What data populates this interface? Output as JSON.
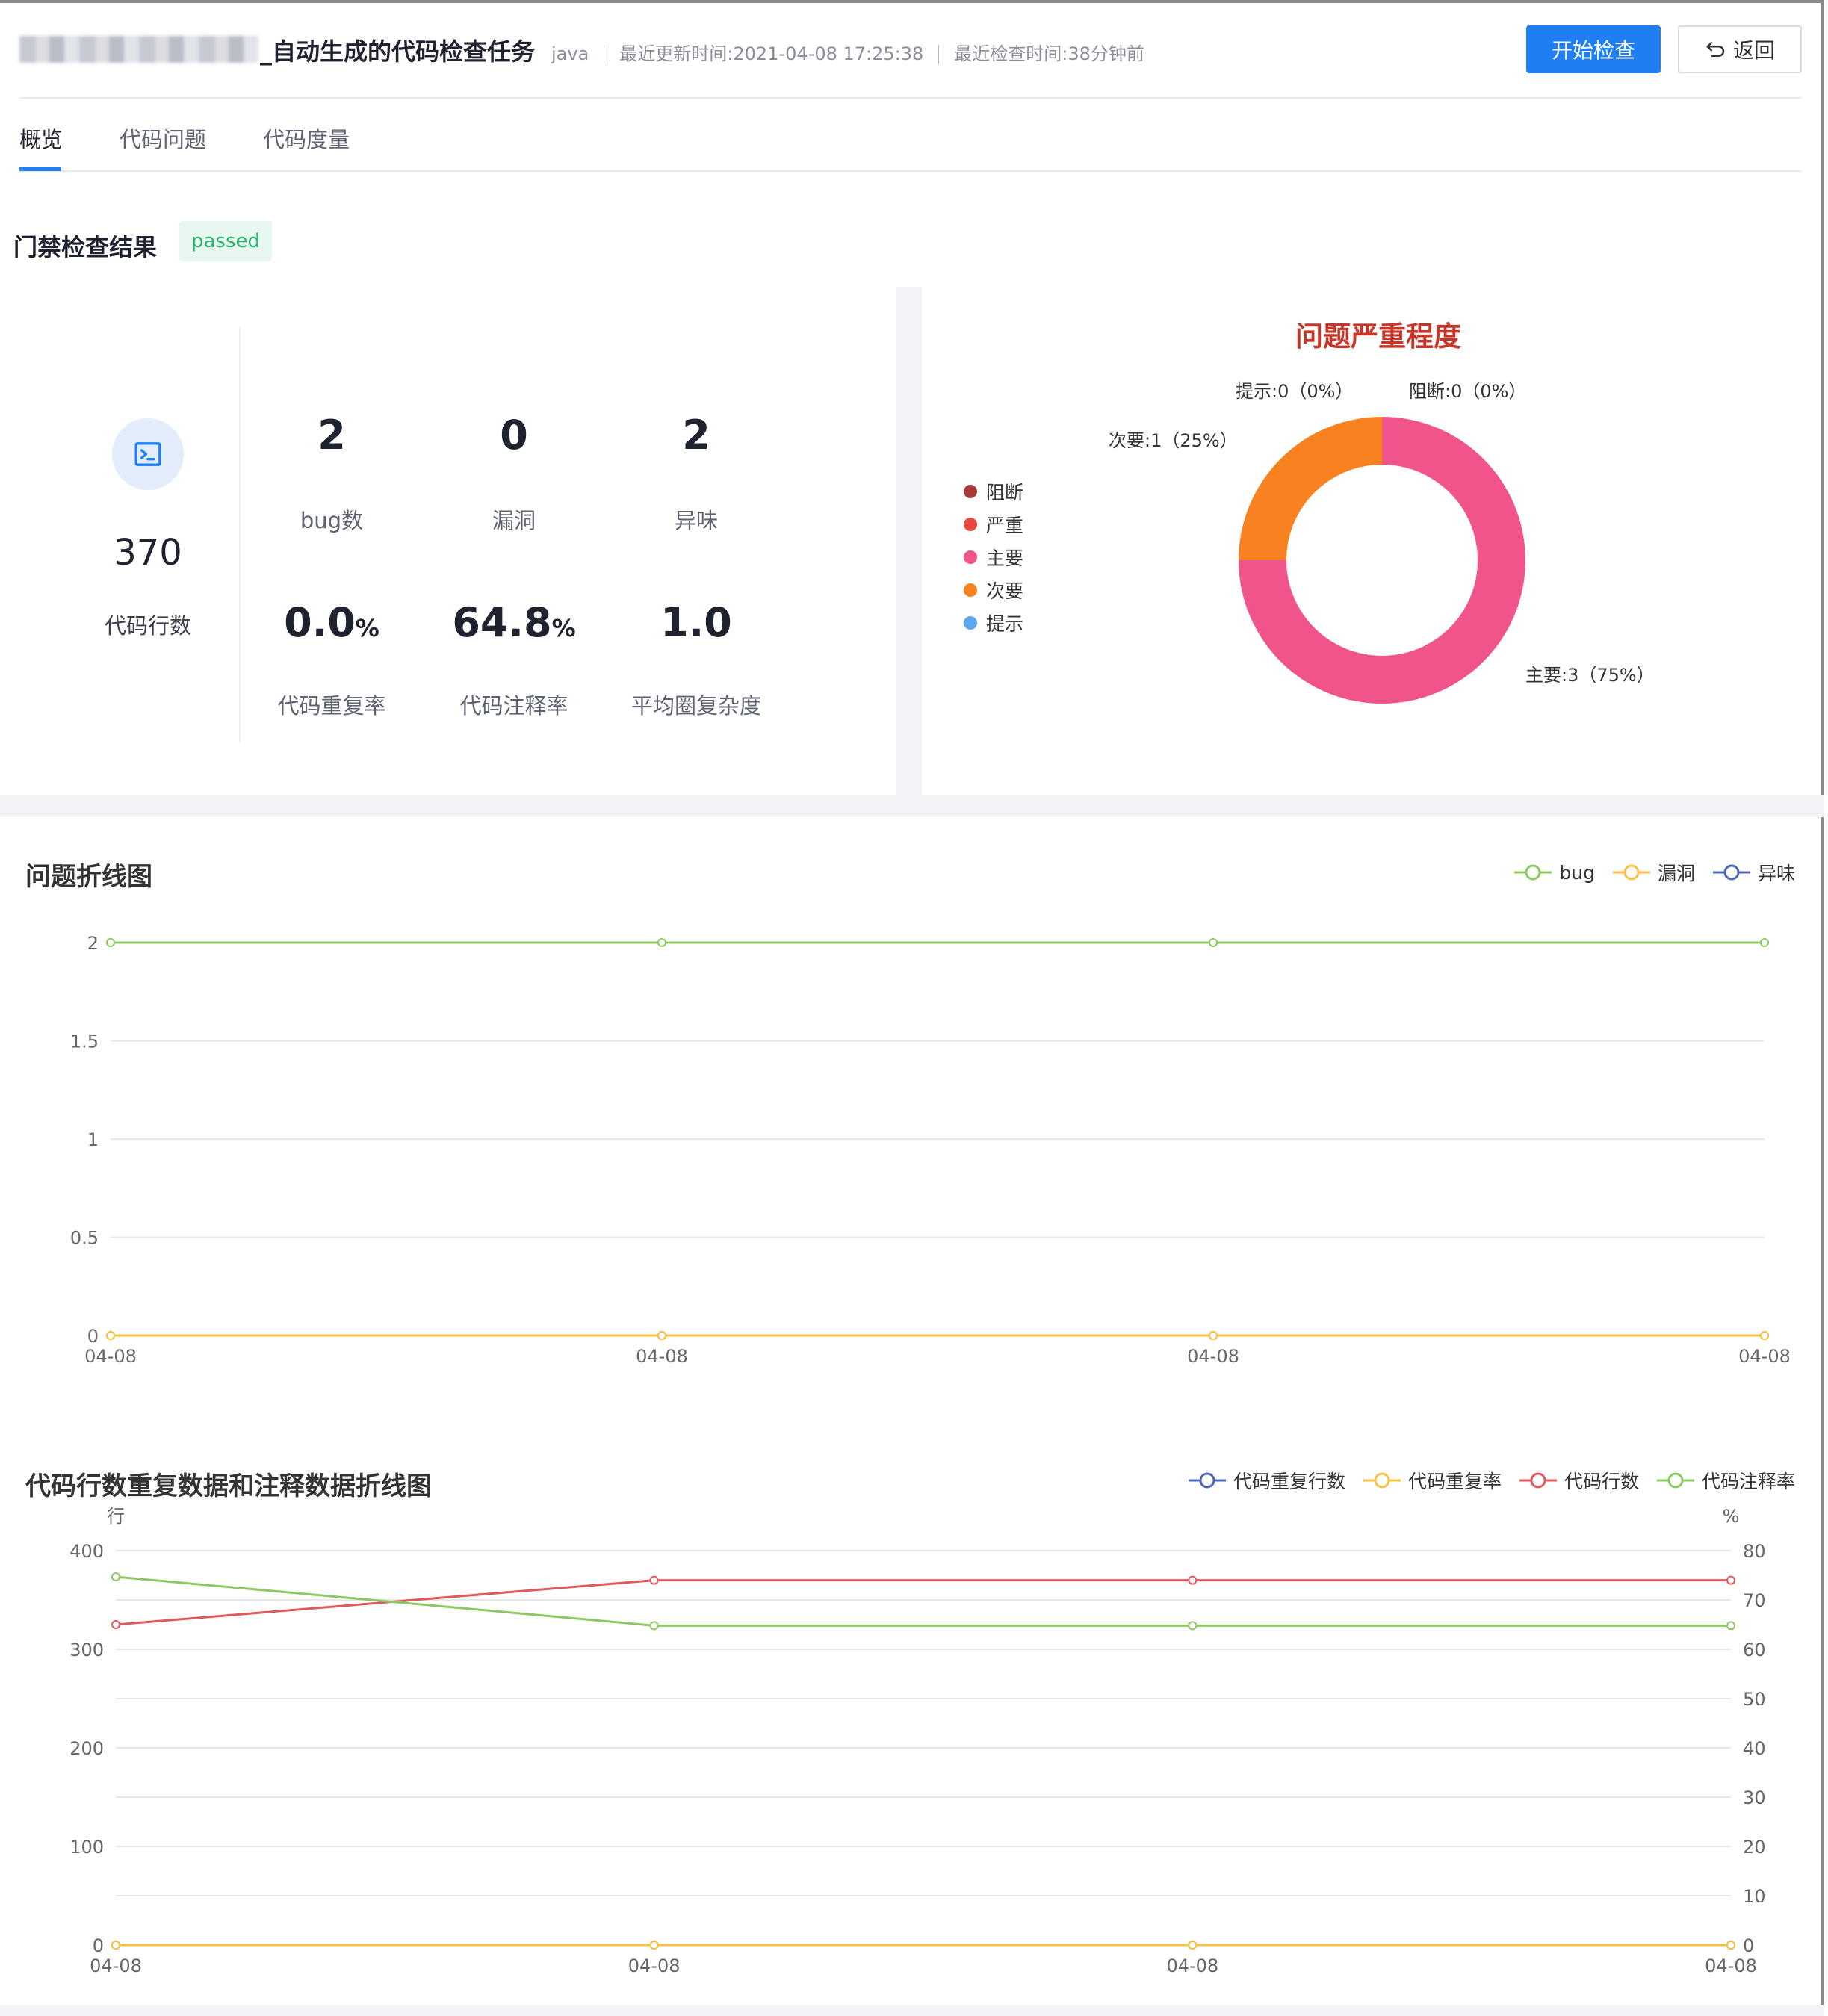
{
  "header": {
    "task_title": "_自动生成的代码检查任务",
    "language": "java",
    "updated_at": "最近更新时间:2021-04-08 17:25:38",
    "checked_at": "最近检查时间:38分钟前",
    "start_button": "开始检查",
    "back_button": "返回"
  },
  "tabs": [
    {
      "label": "概览",
      "active": true
    },
    {
      "label": "代码问题",
      "active": false
    },
    {
      "label": "代码度量",
      "active": false
    }
  ],
  "gate": {
    "title": "门禁检查结果",
    "status": "passed",
    "status_color": "#27b36b"
  },
  "stats": {
    "lines_of_code": {
      "value": "370",
      "label": "代码行数",
      "icon": "terminal-icon"
    },
    "bugs": {
      "value": "2",
      "label": "bug数"
    },
    "vulnerabilities": {
      "value": "0",
      "label": "漏洞"
    },
    "code_smells": {
      "value": "2",
      "label": "异味"
    },
    "duplication": {
      "value": "0.0",
      "unit": "%",
      "label": "代码重复率"
    },
    "comment_rate": {
      "value": "64.8",
      "unit": "%",
      "label": "代码注释率"
    },
    "complexity": {
      "value": "1.0",
      "label": "平均圈复杂度"
    }
  },
  "severity_chart": {
    "title": "问题严重程度",
    "legend": [
      {
        "label": "阻断",
        "color": "#a83a3a"
      },
      {
        "label": "严重",
        "color": "#e8483d"
      },
      {
        "label": "主要",
        "color": "#f0548b"
      },
      {
        "label": "次要",
        "color": "#f8821f"
      },
      {
        "label": "提示",
        "color": "#5ca8ef"
      }
    ],
    "labels": {
      "blocker": "阻断:0（0%）",
      "info": "提示:0（0%）",
      "minor": "次要:1（25%）",
      "major": "主要:3（75%）"
    }
  },
  "issue_chart": {
    "title": "问题折线图",
    "legend": [
      "bug",
      "漏洞",
      "异味"
    ],
    "y_ticks": [
      "2",
      "1.5",
      "1",
      "0.5",
      "0"
    ],
    "x_ticks": [
      "04-08",
      "04-08",
      "04-08",
      "04-08"
    ]
  },
  "metric_chart": {
    "title": "代码行数重复数据和注释数据折线图",
    "legend": [
      "代码重复行数",
      "代码重复率",
      "代码行数",
      "代码注释率"
    ],
    "left_unit": "行",
    "right_unit": "%",
    "left_ticks": [
      "400",
      "300",
      "200",
      "100",
      "0"
    ],
    "right_ticks": [
      "80",
      "70",
      "60",
      "50",
      "40",
      "30",
      "20",
      "10",
      "0"
    ],
    "x_ticks": [
      "04-08",
      "04-08",
      "04-08",
      "04-08"
    ]
  },
  "chart_data": [
    {
      "type": "pie",
      "title": "问题严重程度",
      "categories": [
        "阻断",
        "严重",
        "主要",
        "次要",
        "提示"
      ],
      "values": [
        0,
        0,
        3,
        1,
        0
      ],
      "colors": [
        "#a83a3a",
        "#e8483d",
        "#f0548b",
        "#f8821f",
        "#5ca8ef"
      ],
      "legend": "left"
    },
    {
      "type": "line",
      "title": "问题折线图",
      "x": [
        "04-08",
        "04-08",
        "04-08",
        "04-08"
      ],
      "series": [
        {
          "name": "bug",
          "values": [
            2,
            2,
            2,
            2
          ],
          "color": "#8cc963"
        },
        {
          "name": "漏洞",
          "values": [
            0,
            0,
            0,
            0
          ],
          "color": "#f7c244"
        },
        {
          "name": "异味",
          "values": [
            0,
            0,
            0,
            0
          ],
          "color": "#4b66b8"
        }
      ],
      "ylim": [
        0,
        2
      ],
      "grid": true,
      "legend": "top-right"
    },
    {
      "type": "line",
      "title": "代码行数重复数据和注释数据折线图",
      "x": [
        "04-08",
        "04-08",
        "04-08",
        "04-08"
      ],
      "series": [
        {
          "name": "代码重复行数",
          "values": [
            0,
            0,
            0,
            0
          ],
          "axis": "left",
          "color": "#4b66b8"
        },
        {
          "name": "代码重复率",
          "values": [
            0,
            0,
            0,
            0
          ],
          "axis": "right",
          "color": "#f7c244"
        },
        {
          "name": "代码行数",
          "values": [
            325,
            370,
            370,
            370
          ],
          "axis": "left",
          "color": "#e0595b"
        },
        {
          "name": "代码注释率",
          "values": [
            74.7,
            64.8,
            64.8,
            64.8
          ],
          "axis": "right",
          "color": "#8cc963"
        }
      ],
      "ylim_left": [
        0,
        400
      ],
      "ylim_right": [
        0,
        80
      ],
      "ylabel_left": "行",
      "ylabel_right": "%",
      "grid": true,
      "legend": "top-right"
    }
  ]
}
